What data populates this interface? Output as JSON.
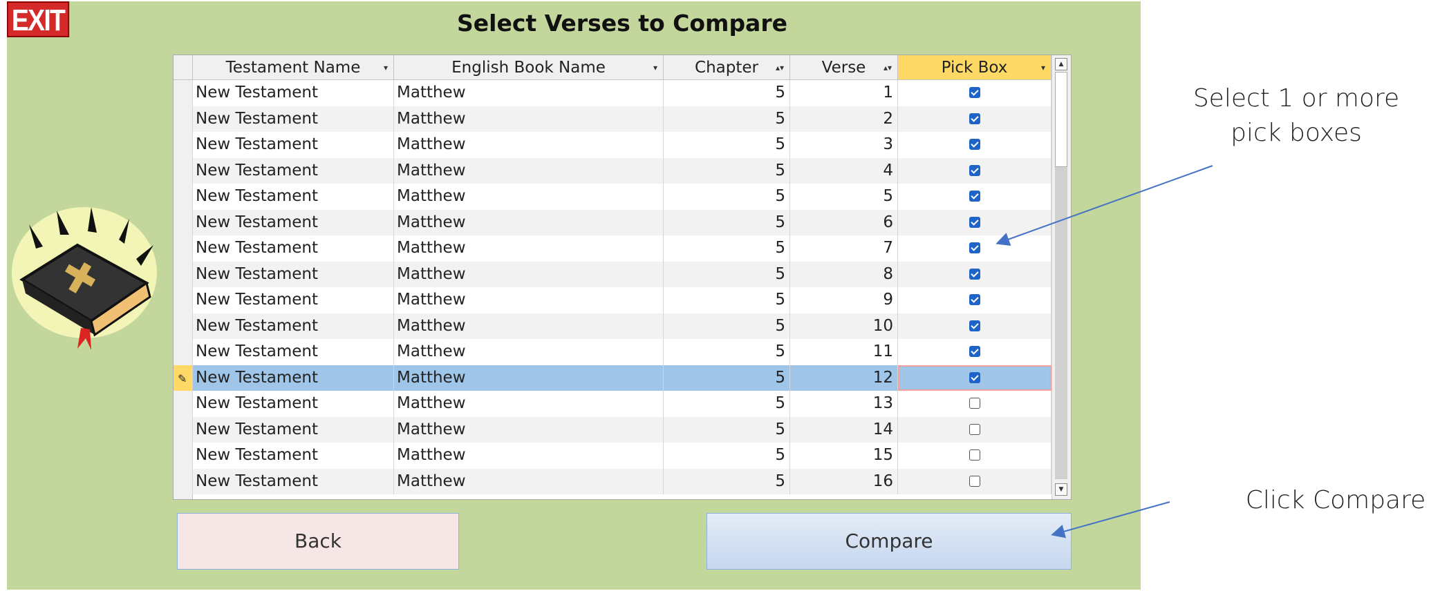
{
  "window": {
    "title": "Select Verses to Compare",
    "exit_label": "EXIT"
  },
  "grid": {
    "columns": [
      "Testament Name",
      "English Book Name",
      "Chapter",
      "Verse",
      "Pick Box"
    ],
    "rows": [
      {
        "testament": "New Testament",
        "book": "Matthew",
        "chapter": "5",
        "verse": "1",
        "picked": true
      },
      {
        "testament": "New Testament",
        "book": "Matthew",
        "chapter": "5",
        "verse": "2",
        "picked": true
      },
      {
        "testament": "New Testament",
        "book": "Matthew",
        "chapter": "5",
        "verse": "3",
        "picked": true
      },
      {
        "testament": "New Testament",
        "book": "Matthew",
        "chapter": "5",
        "verse": "4",
        "picked": true
      },
      {
        "testament": "New Testament",
        "book": "Matthew",
        "chapter": "5",
        "verse": "5",
        "picked": true
      },
      {
        "testament": "New Testament",
        "book": "Matthew",
        "chapter": "5",
        "verse": "6",
        "picked": true
      },
      {
        "testament": "New Testament",
        "book": "Matthew",
        "chapter": "5",
        "verse": "7",
        "picked": true
      },
      {
        "testament": "New Testament",
        "book": "Matthew",
        "chapter": "5",
        "verse": "8",
        "picked": true
      },
      {
        "testament": "New Testament",
        "book": "Matthew",
        "chapter": "5",
        "verse": "9",
        "picked": true
      },
      {
        "testament": "New Testament",
        "book": "Matthew",
        "chapter": "5",
        "verse": "10",
        "picked": true
      },
      {
        "testament": "New Testament",
        "book": "Matthew",
        "chapter": "5",
        "verse": "11",
        "picked": true
      },
      {
        "testament": "New Testament",
        "book": "Matthew",
        "chapter": "5",
        "verse": "12",
        "picked": true,
        "selected": true
      },
      {
        "testament": "New Testament",
        "book": "Matthew",
        "chapter": "5",
        "verse": "13",
        "picked": false
      },
      {
        "testament": "New Testament",
        "book": "Matthew",
        "chapter": "5",
        "verse": "14",
        "picked": false
      },
      {
        "testament": "New Testament",
        "book": "Matthew",
        "chapter": "5",
        "verse": "15",
        "picked": false
      },
      {
        "testament": "New Testament",
        "book": "Matthew",
        "chapter": "5",
        "verse": "16",
        "picked": false
      }
    ]
  },
  "buttons": {
    "back_label": "Back",
    "compare_label": "Compare"
  },
  "annotations": {
    "pick_note": "Select 1 or more pick boxes",
    "compare_note": "Click Compare"
  },
  "icons": {
    "exit": "exit-sign-icon",
    "bible": "bible-icon",
    "edit_row": "pencil-icon"
  },
  "colors": {
    "form_bg": "#c3d69b",
    "pick_header": "#ffd966",
    "selected_row": "#9fc5e8",
    "checkbox": "#1e64c8",
    "arrow": "#4472c4"
  }
}
